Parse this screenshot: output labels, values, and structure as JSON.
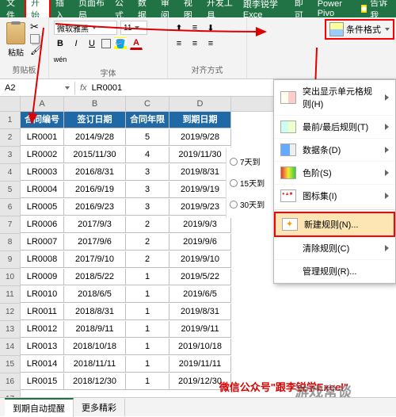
{
  "tabs": {
    "file": "文件",
    "home": "开始",
    "insert": "插入",
    "layout": "页面布局",
    "formula": "公式",
    "data": "数据",
    "review": "审阅",
    "view": "视图",
    "dev": "开发工具",
    "addon": "跟李锐学Exce",
    "more": "即可",
    "powerpivot": "Power Pivo"
  },
  "tellme": "告诉我",
  "ribbon": {
    "clipboard_label": "剪贴板",
    "paste": "粘贴",
    "font_label": "字体",
    "font_name": "微软雅黑",
    "font_size": "11",
    "align_label": "对齐方式",
    "condfmt": "条件格式"
  },
  "namebox": "A2",
  "formula": "LR0001",
  "cols": [
    "A",
    "B",
    "C",
    "D"
  ],
  "headers": [
    "合同编号",
    "签订日期",
    "合同年限",
    "到期日期"
  ],
  "rows": [
    [
      "LR0001",
      "2014/9/28",
      "5",
      "2019/9/28"
    ],
    [
      "LR0002",
      "2015/11/30",
      "4",
      "2019/11/30"
    ],
    [
      "LR0003",
      "2016/8/31",
      "3",
      "2019/8/31"
    ],
    [
      "LR0004",
      "2016/9/19",
      "3",
      "2019/9/19"
    ],
    [
      "LR0005",
      "2016/9/23",
      "3",
      "2019/9/23"
    ],
    [
      "LR0006",
      "2017/9/3",
      "2",
      "2019/9/3"
    ],
    [
      "LR0007",
      "2017/9/6",
      "2",
      "2019/9/6"
    ],
    [
      "LR0008",
      "2017/9/10",
      "2",
      "2019/9/10"
    ],
    [
      "LR0009",
      "2018/5/22",
      "1",
      "2019/5/22"
    ],
    [
      "LR0010",
      "2018/6/5",
      "1",
      "2019/6/5"
    ],
    [
      "LR0011",
      "2018/8/31",
      "1",
      "2019/8/31"
    ],
    [
      "LR0012",
      "2018/9/11",
      "1",
      "2019/9/11"
    ],
    [
      "LR0013",
      "2018/10/18",
      "1",
      "2019/10/18"
    ],
    [
      "LR0014",
      "2018/11/11",
      "1",
      "2019/11/11"
    ],
    [
      "LR0015",
      "2018/12/30",
      "1",
      "2019/12/30"
    ]
  ],
  "cf_menu": {
    "highlight": "突出显示单元格规则(H)",
    "toprules": "最前/最后规则(T)",
    "databars": "数据条(D)",
    "colorscale": "色阶(S)",
    "iconsets": "图标集(I)",
    "newrule": "新建规则(N)...",
    "clear": "清除规则(C)",
    "manage": "管理规则(R)..."
  },
  "date_opts": [
    "7天到",
    "15天到",
    "30天到"
  ],
  "sheet_tabs": {
    "t1": "到期自动提醒",
    "t2": "更多精彩"
  },
  "wx": "微信公众号\"跟李锐学Excel\"",
  "watermark": "游戏常谈"
}
